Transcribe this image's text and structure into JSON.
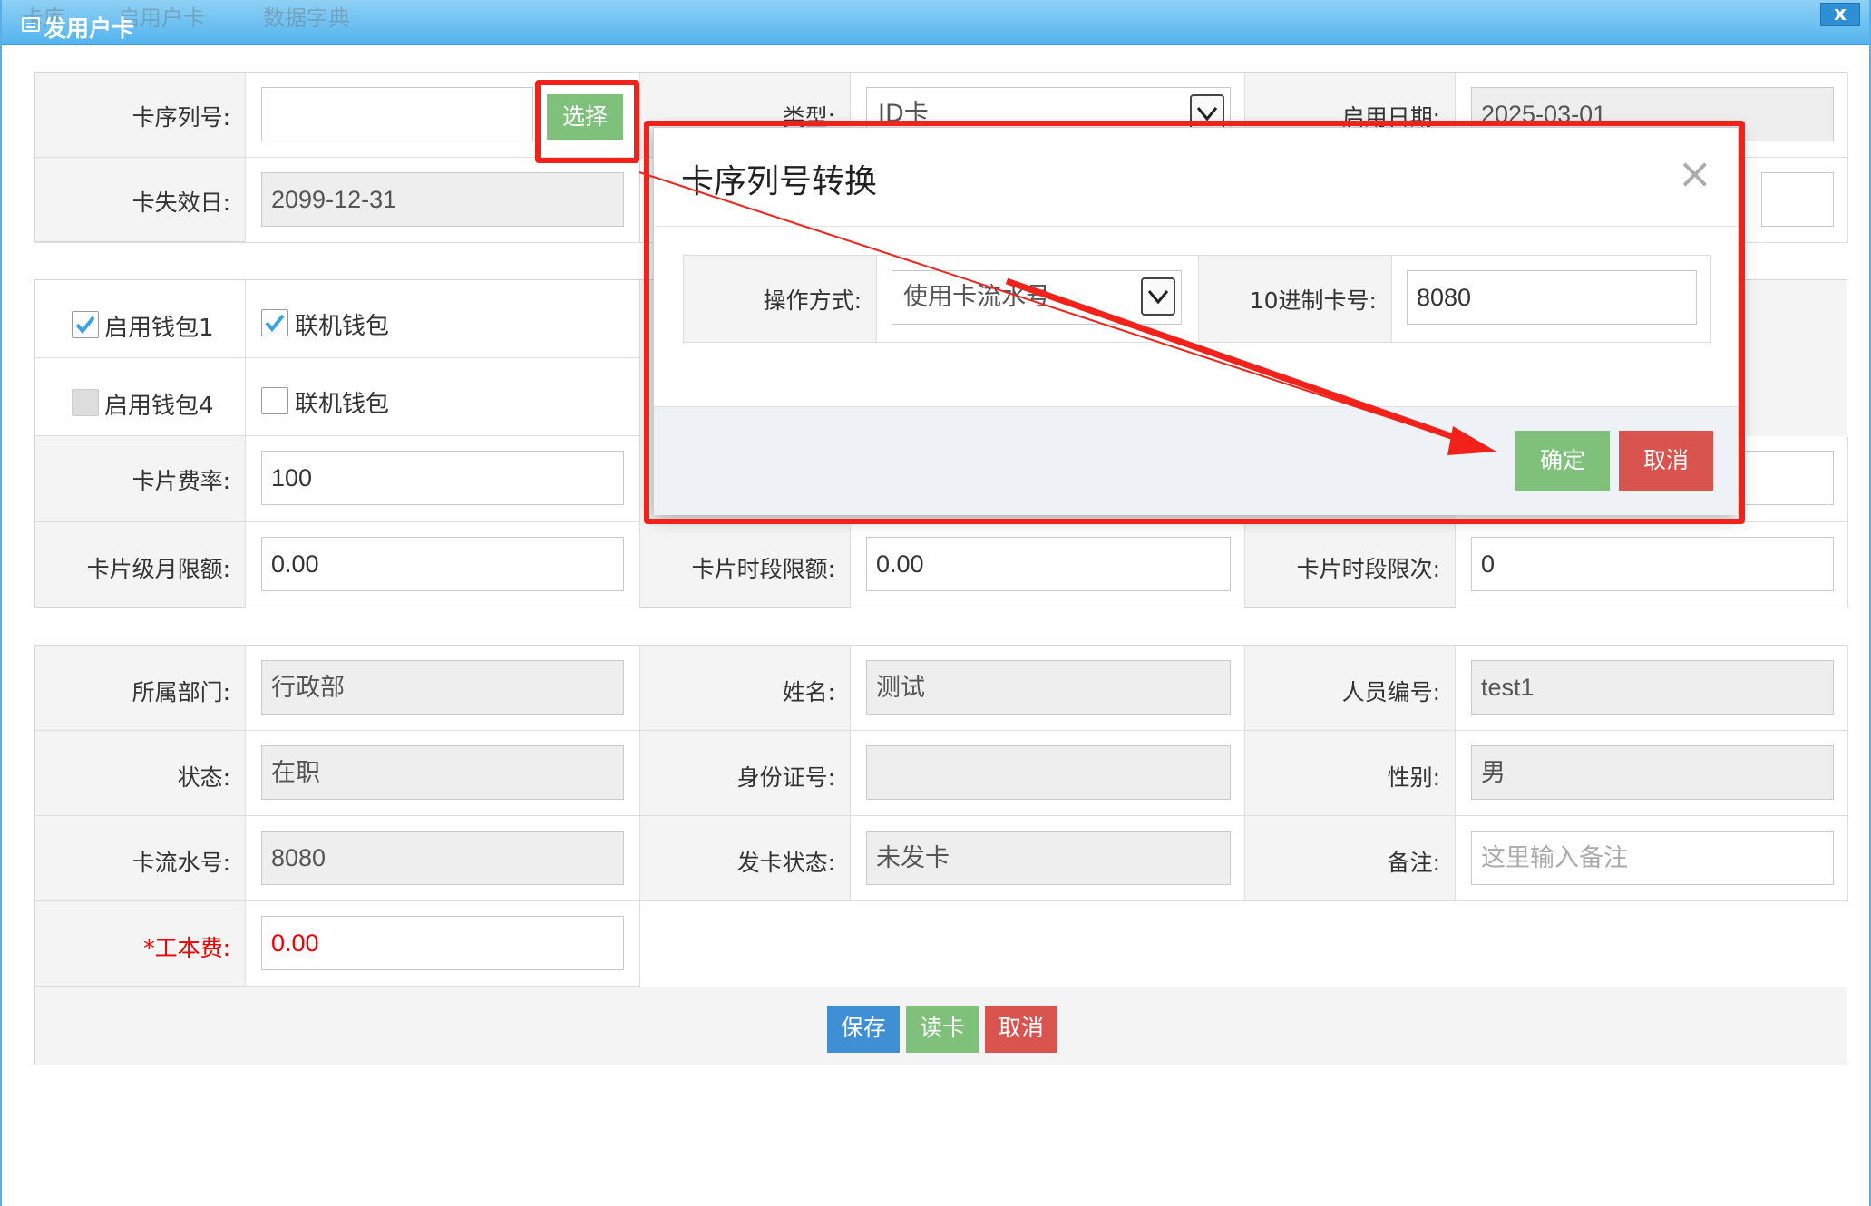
{
  "background_tabs": [
    "卡库",
    "启用户卡",
    "数据字典"
  ],
  "window": {
    "title": "发用户卡",
    "close_label": "x"
  },
  "section1": {
    "card_serial_label": "卡序列号:",
    "card_serial_value": "",
    "select_button": "选择",
    "type_label": "类型:",
    "type_value": "ID卡",
    "start_date_label": "启用日期:",
    "start_date_value": "2025-03-01",
    "expire_label": "卡失效日:",
    "expire_value": "2099-12-31"
  },
  "section2": {
    "wallet1_label": "启用钱包1",
    "wallet1_checked": true,
    "online_wallet1_label": "联机钱包",
    "online_wallet1_checked": true,
    "wallet4_label": "启用钱包4",
    "wallet4_checked": false,
    "online_wallet4_label": "联机钱包",
    "online_wallet4_checked": false,
    "fee_rate_label": "卡片费率:",
    "fee_rate_value": "100",
    "monthly_limit_label": "卡片级月限额:",
    "monthly_limit_value": "0.00",
    "period_limit_label": "卡片时段限额:",
    "period_limit_value": "0.00",
    "period_count_label": "卡片时段限次:",
    "period_count_value": "0"
  },
  "section3": {
    "dept_label": "所属部门:",
    "dept_value": "行政部",
    "name_label": "姓名:",
    "name_value": "测试",
    "emp_no_label": "人员编号:",
    "emp_no_value": "test1",
    "status_label": "状态:",
    "status_value": "在职",
    "id_no_label": "身份证号:",
    "id_no_value": "",
    "gender_label": "性别:",
    "gender_value": "男",
    "card_flow_label": "卡流水号:",
    "card_flow_value": "8080",
    "issue_status_label": "发卡状态:",
    "issue_status_value": "未发卡",
    "remark_label": "备注:",
    "remark_placeholder": "这里输入备注",
    "cost_star": "*",
    "cost_label": "工本费:",
    "cost_value": "0.00"
  },
  "actions": {
    "save": "保存",
    "read_card": "读卡",
    "cancel": "取消"
  },
  "dialog": {
    "title": "卡序列号转换",
    "close": "×",
    "op_label": "操作方式:",
    "op_value": "使用卡流水号",
    "dec_label": "10进制卡号:",
    "dec_value": "8080",
    "ok": "确定",
    "cancel": "取消"
  },
  "colors": {
    "annotation": "#f2221b",
    "green": "#7fc07b",
    "blue": "#3e8fd4",
    "red": "#d9534f",
    "titlebar": "#52b4ee"
  }
}
